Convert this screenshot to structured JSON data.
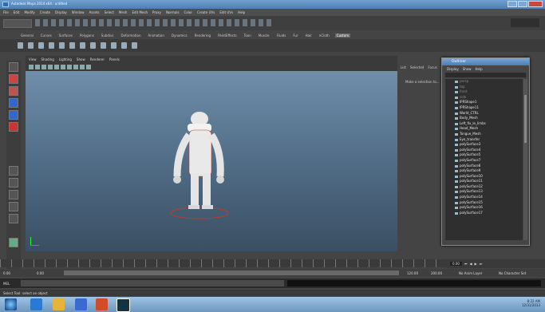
{
  "window": {
    "title": "Autodesk Maya 2014 x64 : untitled"
  },
  "menubar": {
    "items": [
      "File",
      "Edit",
      "Modify",
      "Create",
      "Display",
      "Window",
      "Assets",
      "Select",
      "Mesh",
      "Edit Mesh",
      "Proxy",
      "Normals",
      "Color",
      "Create UVs",
      "Edit UVs",
      "Help"
    ]
  },
  "shelf": {
    "tabs": [
      "General",
      "Curves",
      "Surfaces",
      "Polygons",
      "Subdivs",
      "Deformation",
      "Animation",
      "Dynamics",
      "Rendering",
      "PaintEffects",
      "Toon",
      "Muscle",
      "Fluids",
      "Fur",
      "Hair",
      "nCloth",
      "Custom"
    ],
    "active": "Custom"
  },
  "viewport": {
    "menu": [
      "View",
      "Shading",
      "Lighting",
      "Show",
      "Renderer",
      "Panels"
    ]
  },
  "attribute_editor": {
    "tabs": [
      "List",
      "Selected",
      "Focus"
    ],
    "message": "Make a selection to..."
  },
  "outliner": {
    "title": "Outliner",
    "menu": [
      "Display",
      "Show",
      "Help"
    ],
    "items": [
      {
        "label": "persp",
        "dim": true
      },
      {
        "label": "top",
        "dim": true
      },
      {
        "label": "front",
        "dim": true
      },
      {
        "label": "side",
        "dim": true
      },
      {
        "label": "IPRShape1",
        "dim": false
      },
      {
        "label": "IPRShape11",
        "dim": false
      },
      {
        "label": "World_CTRL",
        "dim": false
      },
      {
        "label": "Body_Mesh",
        "dim": false
      },
      {
        "label": "Left_fix_le_limbs",
        "dim": false
      },
      {
        "label": "Head_Mesh",
        "dim": false
      },
      {
        "label": "Tongue_Mesh",
        "dim": false
      },
      {
        "label": "Eye_transfer",
        "dim": false
      },
      {
        "label": "polySurface3",
        "dim": false
      },
      {
        "label": "polySurface4",
        "dim": false
      },
      {
        "label": "polySurface5",
        "dim": false
      },
      {
        "label": "polySurface7",
        "dim": false
      },
      {
        "label": "polySurface8",
        "dim": false
      },
      {
        "label": "polySurface9",
        "dim": false
      },
      {
        "label": "polySurface10",
        "dim": false
      },
      {
        "label": "polySurface11",
        "dim": false
      },
      {
        "label": "polySurface12",
        "dim": false
      },
      {
        "label": "polySurface13",
        "dim": false
      },
      {
        "label": "polySurface14",
        "dim": false
      },
      {
        "label": "polySurface15",
        "dim": false
      },
      {
        "label": "polySurface16",
        "dim": false
      },
      {
        "label": "polySurface17",
        "dim": false
      }
    ]
  },
  "range": {
    "start": "0.00",
    "start2": "0.00",
    "frame": "1",
    "end": "120.00",
    "end2": "200.00",
    "current": "0.00"
  },
  "playback": {
    "no_anim_layer": "No Anim Layer",
    "no_character_set": "No Character Set"
  },
  "mel": {
    "label": "MEL"
  },
  "helpline": {
    "text": "Select Tool: select an object"
  },
  "taskbar": {
    "time": "8:22 AM",
    "date": "12/31/2013"
  },
  "colors": {
    "viewport_top": "#6f8eab",
    "viewport_bottom": "#3a4f63",
    "accent": "#4e7db3"
  }
}
